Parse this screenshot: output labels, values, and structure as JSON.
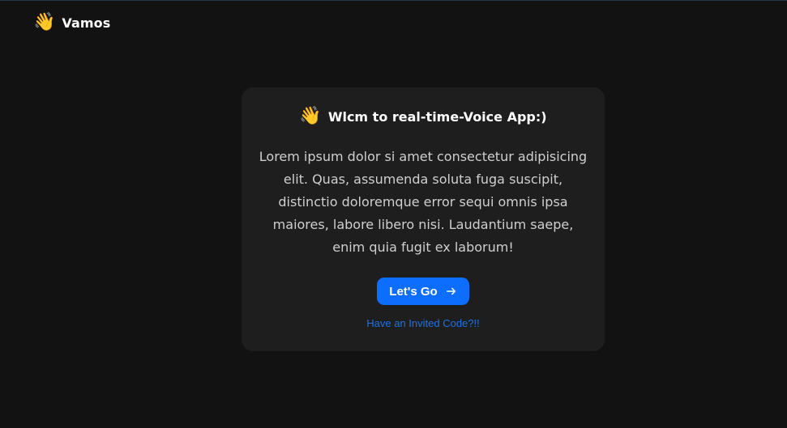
{
  "navbar": {
    "brand_icon": "👋",
    "brand_name": "Vamos"
  },
  "welcome_card": {
    "title_icon": "👋",
    "title": "Wlcm to real-time-Voice App:)",
    "description": "Lorem ipsum dolor si amet consectetur adipisicing elit. Quas, assumenda soluta fuga suscipit, distinctio doloremque error sequi omnis ipsa maiores, labore libero nisi. Laudantium saepe, enim quia fugit ex laborum!",
    "primary_button_label": "Let's Go",
    "primary_button_icon": "arrow-right-icon",
    "invite_link": "Have an Invited Code?!!"
  },
  "colors": {
    "background": "#121212",
    "card": "#1e1e1e",
    "accent": "#0d6efd",
    "link": "#1a73e8"
  }
}
